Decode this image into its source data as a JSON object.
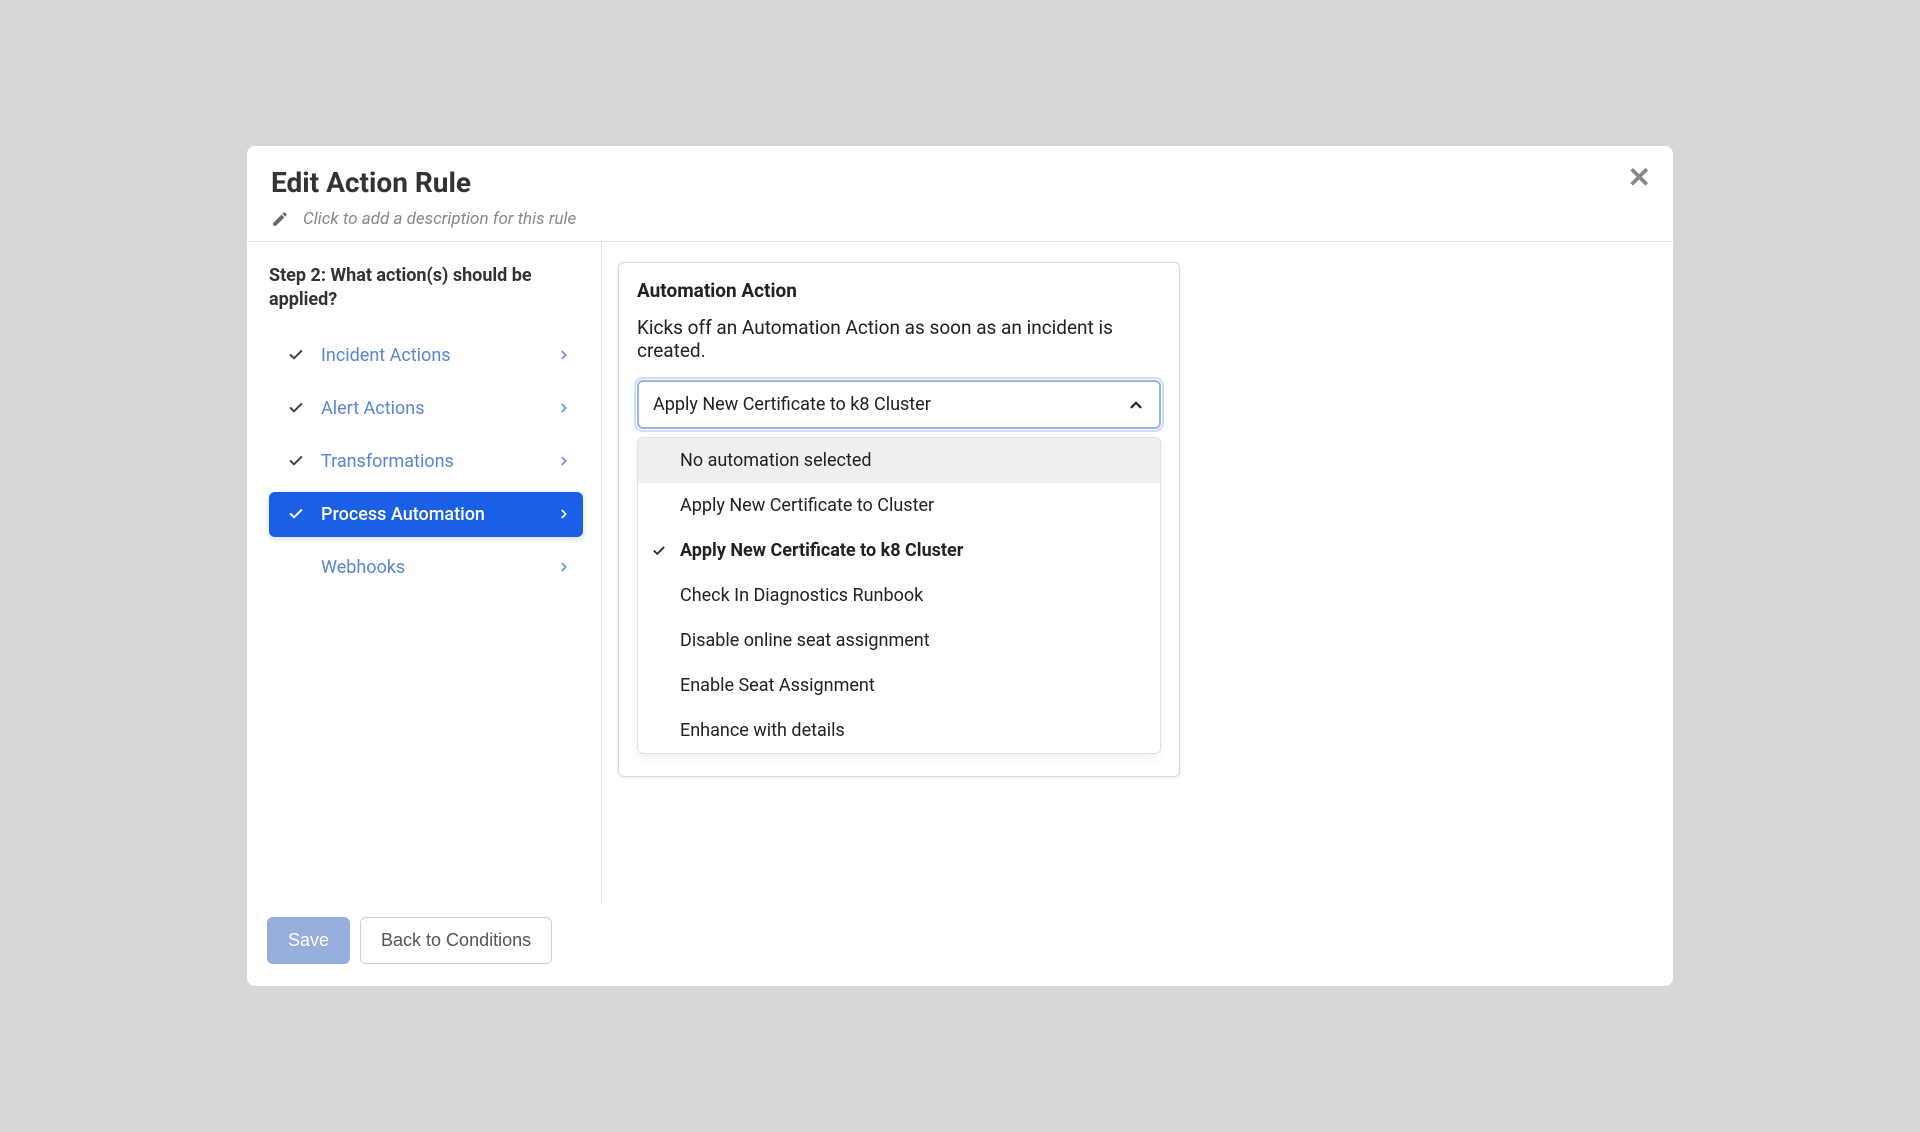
{
  "header": {
    "title": "Edit Action Rule",
    "description_placeholder": "Click to add a description for this rule"
  },
  "sidebar": {
    "step_label": "Step 2: What action(s) should be applied?",
    "items": [
      {
        "label": "Incident Actions",
        "checked": true,
        "active": false
      },
      {
        "label": "Alert Actions",
        "checked": true,
        "active": false
      },
      {
        "label": "Transformations",
        "checked": true,
        "active": false
      },
      {
        "label": "Process Automation",
        "checked": true,
        "active": true
      },
      {
        "label": "Webhooks",
        "checked": false,
        "active": false
      }
    ]
  },
  "action_card": {
    "title": "Automation Action",
    "description": "Kicks off an Automation Action as soon as an incident is created.",
    "select_value": "Apply New Certificate to k8 Cluster",
    "options": [
      {
        "label": "No automation selected",
        "highlight": true,
        "selected": false
      },
      {
        "label": "Apply New Certificate to Cluster",
        "highlight": false,
        "selected": false
      },
      {
        "label": "Apply New Certificate to k8 Cluster",
        "highlight": false,
        "selected": true
      },
      {
        "label": "Check In Diagnostics Runbook",
        "highlight": false,
        "selected": false
      },
      {
        "label": "Disable online seat assignment",
        "highlight": false,
        "selected": false
      },
      {
        "label": "Enable Seat Assignment",
        "highlight": false,
        "selected": false
      },
      {
        "label": "Enhance with details",
        "highlight": false,
        "selected": false
      }
    ]
  },
  "footer": {
    "save_label": "Save",
    "back_label": "Back to Conditions"
  }
}
